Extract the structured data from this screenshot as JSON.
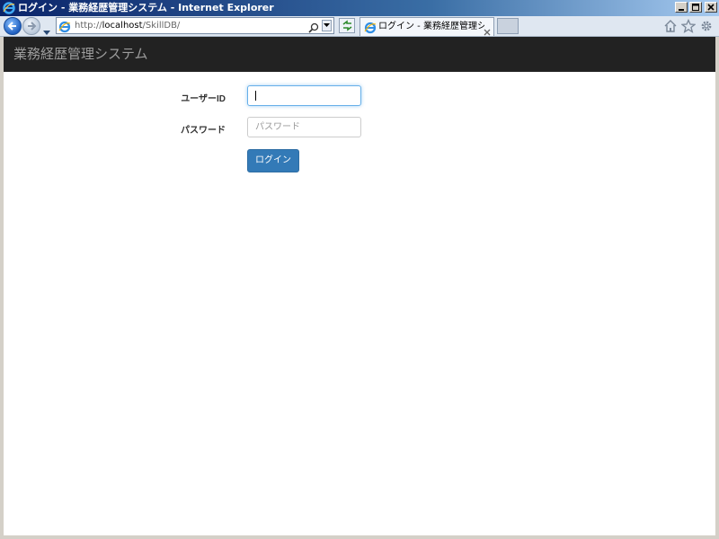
{
  "window": {
    "title": "ログイン - 業務経歴管理システム - Internet Explorer"
  },
  "browser": {
    "address": {
      "scheme": "http://",
      "host": "localhost",
      "path": "/SkillDB/"
    },
    "active_tab": {
      "label": "ログイン - 業務経歴管理シス..."
    },
    "icons": {
      "back": "back-arrow-icon",
      "forward": "forward-arrow-icon",
      "refresh": "refresh-icon",
      "search": "search-icon",
      "home": "home-icon",
      "favorites": "star-icon",
      "tools": "gear-icon"
    }
  },
  "app": {
    "brand": "業務経歴管理システム",
    "navbar_color": "#222222"
  },
  "login_form": {
    "userid_label": "ユーザーID",
    "userid_value": "",
    "password_label": "パスワード",
    "password_placeholder": "パスワード",
    "submit_label": "ログイン",
    "submit_color": "#337ab7"
  }
}
